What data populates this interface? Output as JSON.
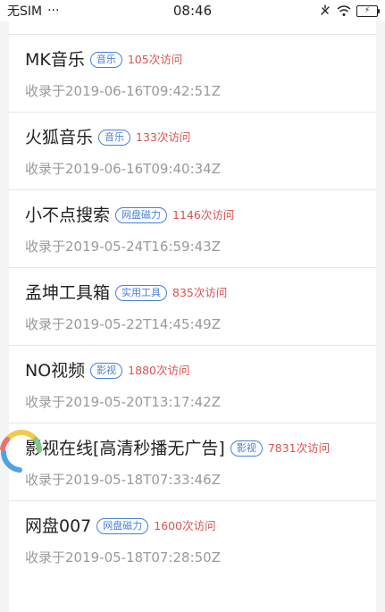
{
  "status_bar": {
    "carrier": "无SIM",
    "dots": "···",
    "time": "08:46",
    "battery_symbol": "⚡"
  },
  "items": [
    {
      "title": "MK音乐",
      "tag": "音乐",
      "visits": "105次访问",
      "date": "收录于2019-06-16T09:42:51Z"
    },
    {
      "title": "火狐音乐",
      "tag": "音乐",
      "visits": "133次访问",
      "date": "收录于2019-06-16T09:40:34Z"
    },
    {
      "title": "小不点搜索",
      "tag": "网盘磁力",
      "visits": "1146次访问",
      "date": "收录于2019-05-24T16:59:43Z"
    },
    {
      "title": "孟坤工具箱",
      "tag": "实用工具",
      "visits": "835次访问",
      "date": "收录于2019-05-22T14:45:49Z"
    },
    {
      "title": "NO视频",
      "tag": "影视",
      "visits": "1880次访问",
      "date": "收录于2019-05-20T13:17:42Z"
    },
    {
      "title": "影视在线[高清秒播无广告]",
      "tag": "影视",
      "visits": "7831次访问",
      "date": "收录于2019-05-18T07:33:46Z"
    },
    {
      "title": "网盘007",
      "tag": "网盘磁力",
      "visits": "1600次访问",
      "date": "收录于2019-05-18T07:28:50Z"
    }
  ],
  "colors": {
    "tag": "#4a7fd6",
    "visits": "#d9534f",
    "date": "#9a9a9a",
    "loader_segments": [
      "#f2c94c",
      "#4fa3e0",
      "#e57373",
      "#81c784"
    ]
  }
}
